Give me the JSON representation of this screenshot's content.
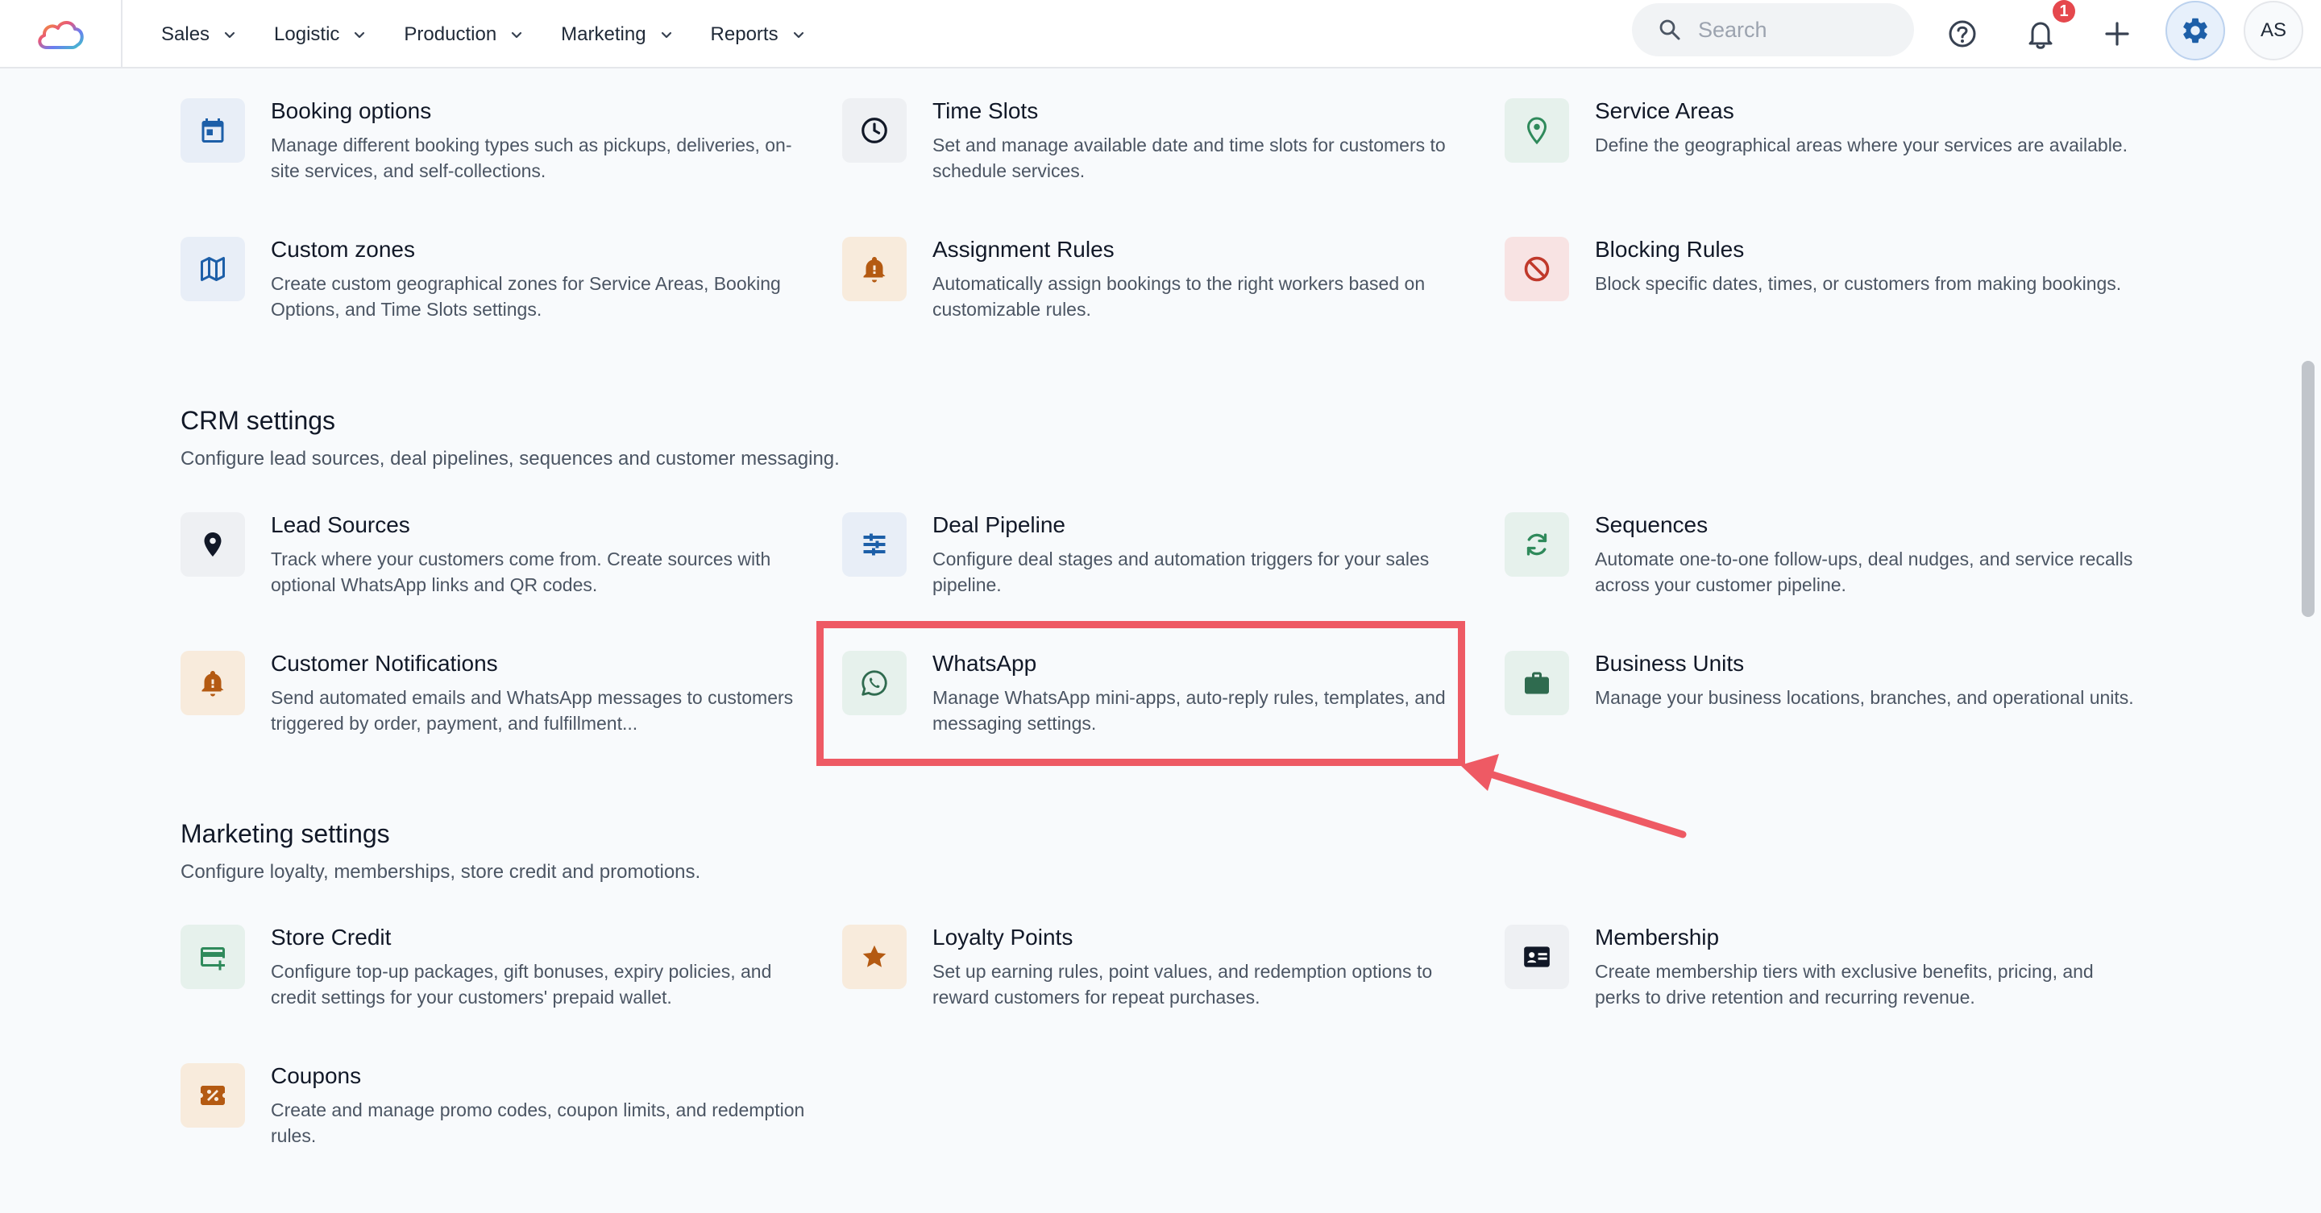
{
  "header": {
    "nav": [
      {
        "label": "Sales"
      },
      {
        "label": "Logistic"
      },
      {
        "label": "Production"
      },
      {
        "label": "Marketing"
      },
      {
        "label": "Reports"
      }
    ],
    "search_placeholder": "Search",
    "notification_count": "1",
    "avatar_initials": "AS"
  },
  "logistics_cards": [
    {
      "title": "Booking options",
      "desc": "Manage different booking types such as pickups, deliveries, on-site services, and self-collections.",
      "icon": "calendar-icon"
    },
    {
      "title": "Time Slots",
      "desc": "Set and manage available date and time slots for customers to schedule services.",
      "icon": "clock-icon"
    },
    {
      "title": "Service Areas",
      "desc": "Define the geographical areas where your services are available.",
      "icon": "map-pin-icon"
    },
    {
      "title": "Custom zones",
      "desc": "Create custom geographical zones for Service Areas, Booking Options, and Time Slots settings.",
      "icon": "map-icon"
    },
    {
      "title": "Assignment Rules",
      "desc": "Automatically assign bookings to the right workers based on customizable rules.",
      "icon": "bell-alert-icon"
    },
    {
      "title": "Blocking Rules",
      "desc": "Block specific dates, times, or customers from making bookings.",
      "icon": "block-icon"
    }
  ],
  "crm": {
    "title": "CRM settings",
    "subtitle": "Configure lead sources, deal pipelines, sequences and customer messaging.",
    "cards": [
      {
        "title": "Lead Sources",
        "desc": "Track where your customers come from. Create sources with optional WhatsApp links and QR codes.",
        "icon": "location-pin-icon"
      },
      {
        "title": "Deal Pipeline",
        "desc": "Configure deal stages and automation triggers for your sales pipeline.",
        "icon": "pipeline-icon"
      },
      {
        "title": "Sequences",
        "desc": "Automate one-to-one follow-ups, deal nudges, and service recalls across your customer pipeline.",
        "icon": "refresh-icon"
      },
      {
        "title": "Customer Notifications",
        "desc": "Send automated emails and WhatsApp messages to customers triggered by order, payment, and fulfillment...",
        "icon": "bell-alert-icon"
      },
      {
        "title": "WhatsApp",
        "desc": "Manage WhatsApp mini-apps, auto-reply rules, templates, and messaging settings.",
        "icon": "whatsapp-icon"
      },
      {
        "title": "Business Units",
        "desc": "Manage your business locations, branches, and operational units.",
        "icon": "briefcase-icon"
      }
    ]
  },
  "marketing": {
    "title": "Marketing settings",
    "subtitle": "Configure loyalty, memberships, store credit and promotions.",
    "cards": [
      {
        "title": "Store Credit",
        "desc": "Configure top-up packages, gift bonuses, expiry policies, and credit settings for your customers' prepaid wallet.",
        "icon": "card-add-icon"
      },
      {
        "title": "Loyalty Points",
        "desc": "Set up earning rules, point values, and redemption options to reward customers for repeat purchases.",
        "icon": "star-icon"
      },
      {
        "title": "Membership",
        "desc": "Create membership tiers with exclusive benefits, pricing, and perks to drive retention and recurring revenue.",
        "icon": "id-card-icon"
      },
      {
        "title": "Coupons",
        "desc": "Create and manage promo codes, coupon limits, and redemption rules.",
        "icon": "coupon-icon"
      }
    ]
  },
  "colors": {
    "accent": "#1d5fa8",
    "highlight": "#ee5a64",
    "badge": "#e5484d"
  }
}
